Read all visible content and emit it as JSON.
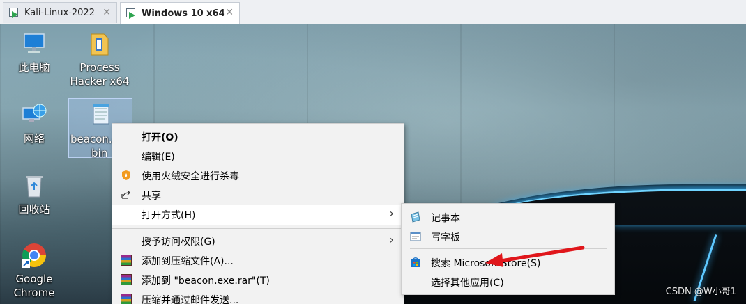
{
  "tabs": [
    {
      "label": "Kali-Linux-2022",
      "close": "✕"
    },
    {
      "label": "Windows 10 x64",
      "close": "✕"
    }
  ],
  "desktop_icons": [
    {
      "label": "此电脑",
      "icon": "computer-icon"
    },
    {
      "label": "Process Hacker x64",
      "icon": "process-hacker-icon"
    },
    {
      "label": "网络",
      "icon": "network-icon"
    },
    {
      "label": "beacon.exe.bin",
      "visible_label_line1": "beacon.e",
      "visible_label_line2": "bin",
      "icon": "notepad-file-icon"
    },
    {
      "label": "回收站",
      "icon": "recycle-bin-icon"
    },
    {
      "label": "Google Chrome",
      "icon": "chrome-icon"
    }
  ],
  "context_menu": {
    "items": [
      {
        "label": "打开(O)",
        "bold": true
      },
      {
        "label": "编辑(E)"
      },
      {
        "label": "使用火绒安全进行杀毒",
        "icon": "huorong-shield-icon"
      },
      {
        "label": "共享",
        "icon": "share-icon"
      },
      {
        "label": "打开方式(H)",
        "submenu": true,
        "highlighted": true
      },
      {
        "label": "授予访问权限(G)",
        "submenu": true
      },
      {
        "label": "添加到压缩文件(A)...",
        "icon": "winrar-icon"
      },
      {
        "label": "添加到 \"beacon.exe.rar\"(T)",
        "icon": "winrar-icon"
      },
      {
        "label": "压缩并通过邮件发送...",
        "icon": "winrar-icon"
      }
    ],
    "arrow_glyph": "›"
  },
  "open_with_menu": {
    "items": [
      {
        "label": "记事本",
        "icon": "notepad-icon"
      },
      {
        "label": "写字板",
        "icon": "wordpad-icon"
      },
      {
        "label": "搜索 Microsoft Store(S)",
        "icon": "store-icon"
      },
      {
        "label": "选择其他应用(C)"
      }
    ]
  },
  "watermark": "CSDN @W小哥1",
  "colors": {
    "annotation_arrow": "#e0161b",
    "neon": "#5fc8ff"
  }
}
